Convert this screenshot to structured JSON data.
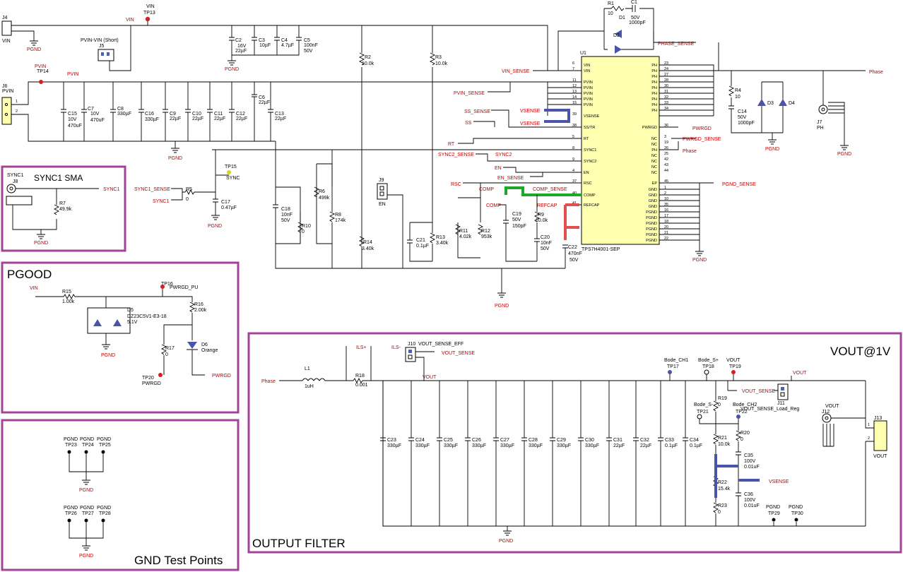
{
  "sections": {
    "sync": "SYNC1 SMA",
    "pgood": "PGOOD",
    "gnd_tp": "GND Test Points",
    "out_filter": "OUTPUT FILTER",
    "vout": "VOUT@1V"
  },
  "ic": {
    "ref": "U1",
    "part": "TPS7H4001-SEP",
    "left_pins": [
      {
        "num": "6",
        "name": "VIN"
      },
      {
        "num": "7",
        "name": "VIN"
      },
      {
        "num": "11",
        "name": "PVIN"
      },
      {
        "num": "12",
        "name": "PVIN"
      },
      {
        "num": "13",
        "name": "PVIN"
      },
      {
        "num": "14",
        "name": "PVIN"
      },
      {
        "num": "15",
        "name": "PVIN"
      },
      {
        "num": "39",
        "name": "VSENSE"
      },
      {
        "num": "38",
        "name": "SS/TR"
      },
      {
        "num": "5",
        "name": "RT"
      },
      {
        "num": "8",
        "name": "SYNC1"
      },
      {
        "num": "9",
        "name": "SYNC2"
      },
      {
        "num": "4",
        "name": "EN"
      },
      {
        "num": "37",
        "name": "RSC"
      },
      {
        "num": "40",
        "name": "COMP"
      },
      {
        "num": "41",
        "name": "REFCAP"
      }
    ],
    "right_pins": [
      {
        "num": "23",
        "name": "PH"
      },
      {
        "num": "24",
        "name": "PH"
      },
      {
        "num": "27",
        "name": "PH"
      },
      {
        "num": "28",
        "name": "PH"
      },
      {
        "num": "30",
        "name": "PH"
      },
      {
        "num": "31",
        "name": "PH"
      },
      {
        "num": "32",
        "name": "PH"
      },
      {
        "num": "33",
        "name": "PH"
      },
      {
        "num": "34",
        "name": "PH"
      },
      {
        "num": "36",
        "name": "PWRGD"
      },
      {
        "num": "3",
        "name": "NC"
      },
      {
        "num": "19",
        "name": "NC"
      },
      {
        "num": "26",
        "name": "PH"
      },
      {
        "num": "25",
        "name": "NC"
      },
      {
        "num": "42",
        "name": "NC"
      },
      {
        "num": "43",
        "name": "NC"
      },
      {
        "num": "44",
        "name": "NC"
      },
      {
        "num": "45",
        "name": "EP"
      },
      {
        "num": "1",
        "name": "GND"
      },
      {
        "num": "2",
        "name": "GND"
      },
      {
        "num": "10",
        "name": "GND"
      },
      {
        "num": "35",
        "name": "GND"
      },
      {
        "num": "16",
        "name": "PGND"
      },
      {
        "num": "17",
        "name": "PGND"
      },
      {
        "num": "18",
        "name": "PGND"
      },
      {
        "num": "20",
        "name": "PGND"
      },
      {
        "num": "21",
        "name": "PGND"
      },
      {
        "num": "22",
        "name": "PGND"
      }
    ]
  },
  "net_labels": {
    "vin_sense": "VIN_SENSE",
    "pvin_sense": "PVIN_SENSE",
    "ss_sense": "SS_SENSE",
    "ss": "SS",
    "vsense": "VSENSE",
    "rt": "RT",
    "sync2_sense": "SYNC2_SENSE",
    "sync2": "SYNC2",
    "en": "EN",
    "en_sense": "EN_SENSE",
    "rsc": "RSC",
    "comp": "COMP",
    "comp_sense": "COMP_SENSE",
    "refcap": "REFCAP",
    "phase_sense": "PHASE_SENSE",
    "phase": "Phase",
    "pwrgd": "PWRGD",
    "pwrgd_sense": "PWRGD_SENSE",
    "pgnd_sense": "PGND_SENSE",
    "sync1": "SYNC1",
    "sync1_sense": "SYNC1_SENSE",
    "ils_p": "ILS+",
    "ils_m": "ILS-",
    "vout_sense": "VOUT_SENSE",
    "vout": "VOUT",
    "vin": "VIN",
    "pvin": "PVIN",
    "pgnd": "PGND"
  },
  "components": {
    "j4": {
      "ref": "J4",
      "net": "VIN"
    },
    "tp13": {
      "ref": "TP13",
      "net": "VIN"
    },
    "j5": {
      "ref": "J5",
      "desc": "PVIN-VIN (Short)"
    },
    "j6": {
      "ref": "J6",
      "net": "PVIN"
    },
    "tp14": {
      "ref": "TP14",
      "net": "PVIN"
    },
    "c2": {
      "ref": "C2",
      "v1": "16V",
      "v2": "22µF"
    },
    "c3": {
      "ref": "C3",
      "v1": "10µF"
    },
    "c4": {
      "ref": "C4",
      "v1": "4.7µF"
    },
    "c5": {
      "ref": "C5",
      "v1": "100nF",
      "v2": "50V"
    },
    "r1": {
      "ref": "R1",
      "v1": "10"
    },
    "c1": {
      "ref": "C1",
      "v1": "50V",
      "v2": "1000pF"
    },
    "d1": {
      "ref": "D1"
    },
    "d2": {
      "ref": "D2"
    },
    "r2": {
      "ref": "R2",
      "v1": "10.0k"
    },
    "r3": {
      "ref": "R3",
      "v1": "10.0k"
    },
    "c15": {
      "ref": "C15",
      "v1": "10V",
      "v2": "470uF"
    },
    "c7": {
      "ref": "C7",
      "v1": "10V",
      "v2": "470uF"
    },
    "c8": {
      "ref": "C8",
      "v1": "330µF"
    },
    "c16": {
      "ref": "C16",
      "v1": "330µF"
    },
    "c9": {
      "ref": "C9",
      "v1": "22µF"
    },
    "c10": {
      "ref": "C10",
      "v1": "22µF"
    },
    "c11": {
      "ref": "C11",
      "v1": "22µF"
    },
    "c12": {
      "ref": "C12",
      "v1": "22µF"
    },
    "c6": {
      "ref": "C6",
      "v1": "22µF"
    },
    "c13": {
      "ref": "C13",
      "v1": "22µF"
    },
    "tp15": {
      "ref": "TP15",
      "net": "SYNC"
    },
    "j8": {
      "ref": "J8",
      "net": "SYNC1"
    },
    "r7": {
      "ref": "R7",
      "v1": "49.9k"
    },
    "r5": {
      "ref": "R5",
      "v1": "0"
    },
    "c17": {
      "ref": "C17",
      "v1": "0.47µF"
    },
    "c18": {
      "ref": "C18",
      "v1": "10nF",
      "v2": "50V"
    },
    "r10": {
      "ref": "R10",
      "v1": "0"
    },
    "r6": {
      "ref": "R6",
      "v1": "499k"
    },
    "r8": {
      "ref": "R8",
      "v1": "174k"
    },
    "r14": {
      "ref": "R14",
      "v1": "3.40k"
    },
    "j9": {
      "ref": "J9",
      "net": "EN"
    },
    "c21": {
      "ref": "C21",
      "v1": "0.1µF"
    },
    "r13": {
      "ref": "R13",
      "v1": "3.40k"
    },
    "r11": {
      "ref": "R11",
      "v1": "4.02k"
    },
    "r12": {
      "ref": "R12",
      "v1": "953k"
    },
    "c19": {
      "ref": "C19",
      "v1": "50V",
      "v2": "150pF"
    },
    "r9": {
      "ref": "R9",
      "v1": "10.0k"
    },
    "c20": {
      "ref": "C20",
      "v1": "10nF",
      "v2": "50V"
    },
    "c22": {
      "ref": "C22",
      "v1": "470nF",
      "v2": "50V"
    },
    "r4": {
      "ref": "R4",
      "v1": "10"
    },
    "c14": {
      "ref": "C14",
      "v1": "50V",
      "v2": "1000pF"
    },
    "d3": {
      "ref": "D3"
    },
    "d4": {
      "ref": "D4"
    },
    "j7": {
      "ref": "J7",
      "net": "PH"
    },
    "r15": {
      "ref": "R15",
      "v1": "1.00k"
    },
    "d5": {
      "ref": "D5",
      "v1": "DZ23C5V1-E3-18",
      "v2": "5.1V"
    },
    "tp16": {
      "ref": "TP16",
      "net": "PWRGD_PU"
    },
    "r16": {
      "ref": "R16",
      "v1": "2.00k"
    },
    "d6": {
      "ref": "D6",
      "v1": "Orange"
    },
    "r17": {
      "ref": "R17",
      "v1": "0"
    },
    "tp20": {
      "ref": "TP20",
      "net": "PWRGD"
    },
    "l1": {
      "ref": "L1",
      "v1": "1uH"
    },
    "r18": {
      "ref": "R18",
      "v1": "0.001"
    },
    "j10": {
      "ref": "J10",
      "desc": "VOUT_SENSE_EFF"
    },
    "c23": {
      "ref": "C23",
      "v1": "330µF"
    },
    "c24": {
      "ref": "C24",
      "v1": "330µF"
    },
    "c25": {
      "ref": "C25",
      "v1": "330µF"
    },
    "c26": {
      "ref": "C26",
      "v1": "330µF"
    },
    "c27": {
      "ref": "C27",
      "v1": "330µF"
    },
    "c28": {
      "ref": "C28",
      "v1": "330µF"
    },
    "c29": {
      "ref": "C29",
      "v1": "330µF"
    },
    "c30": {
      "ref": "C30",
      "v1": "330µF"
    },
    "c31": {
      "ref": "C31",
      "v1": "22µF"
    },
    "c32": {
      "ref": "C32",
      "v1": "22µF"
    },
    "c33": {
      "ref": "C33",
      "v1": "0.1µF"
    },
    "c34": {
      "ref": "C34",
      "v1": "0.1µF"
    },
    "tp17": {
      "ref": "TP17",
      "net": "Bode_CH1"
    },
    "tp18": {
      "ref": "TP18",
      "net": "Bode_S+"
    },
    "tp19": {
      "ref": "TP19",
      "net": "VOUT"
    },
    "tp21": {
      "ref": "TP21",
      "net": "Bode_S-"
    },
    "tp22": {
      "ref": "TP22",
      "net": "Bode_CH2"
    },
    "r19": {
      "ref": "R19",
      "v1": "0"
    },
    "r20": {
      "ref": "R20",
      "v1": "0"
    },
    "r21": {
      "ref": "R21",
      "v1": "10.0k"
    },
    "r22": {
      "ref": "R22",
      "v1": "15.4k"
    },
    "r23": {
      "ref": "R23",
      "v1": "0"
    },
    "c35": {
      "ref": "C35",
      "v1": "100V",
      "v2": "0.01uF"
    },
    "c36": {
      "ref": "C36",
      "v1": "100V",
      "v2": "0.01uF"
    },
    "j11": {
      "ref": "J11",
      "desc": "VOUT_SENSE_Load_Reg"
    },
    "j12": {
      "ref": "J12",
      "net": "VOUT"
    },
    "j13": {
      "ref": "J13",
      "net": "VOUT"
    },
    "tp29": {
      "ref": "TP29",
      "net": "PGND"
    },
    "tp30": {
      "ref": "TP30",
      "net": "PGND"
    },
    "tp23": {
      "ref": "TP23",
      "net": "PGND"
    },
    "tp24": {
      "ref": "TP24",
      "net": "PGND"
    },
    "tp25": {
      "ref": "TP25",
      "net": "PGND"
    },
    "tp26": {
      "ref": "TP26",
      "net": "PGND"
    },
    "tp27": {
      "ref": "TP27",
      "net": "PGND"
    },
    "tp28": {
      "ref": "TP28",
      "net": "PGND"
    }
  },
  "colors": {
    "frame": "#a0449a",
    "net_red": "#c00000",
    "ic_fill": "#ffffb0",
    "hl_blue": "#4a55a8",
    "hl_green": "#1ea82a",
    "hl_red": "#e05050"
  }
}
